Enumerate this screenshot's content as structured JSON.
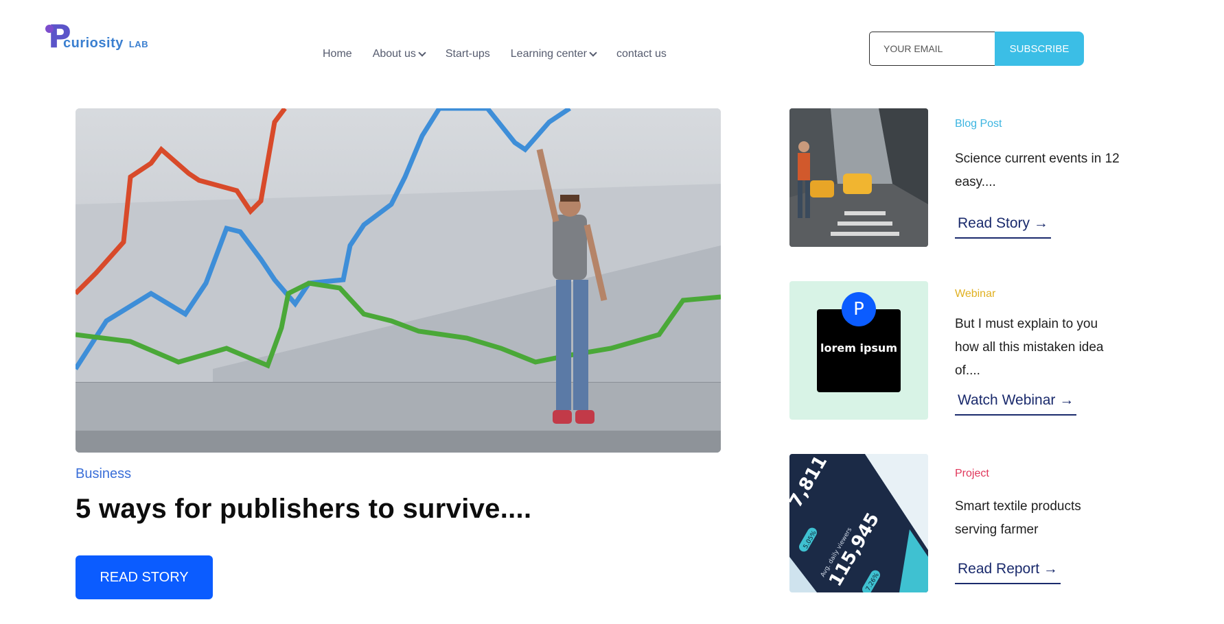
{
  "header": {
    "logo": {
      "letter": "P",
      "word": "curiosity",
      "suffix": "LAB"
    },
    "nav": [
      {
        "label": "Home",
        "dropdown": false
      },
      {
        "label": "About us",
        "dropdown": true
      },
      {
        "label": "Start-ups",
        "dropdown": false
      },
      {
        "label": "Learning center",
        "dropdown": true
      },
      {
        "label": "contact us",
        "dropdown": false
      }
    ],
    "subscribe": {
      "placeholder": "YOUR EMAIL",
      "button": "SUBSCRIBE"
    }
  },
  "hero": {
    "category": "Business",
    "title": "5 ways for publishers to survive....",
    "button": "READ STORY"
  },
  "cards": [
    {
      "tag": "Blog Post",
      "tag_color": "#3bb4e0",
      "text": "Science current events in 12 easy....",
      "link": "Read Story →"
    },
    {
      "tag": "Webinar",
      "tag_color": "#e0b020",
      "text": "But I must explain to you how all this mistaken idea of....",
      "link": "Watch Webinar →",
      "thumb": {
        "avatar_letter": "P",
        "label": "lorem ipsum"
      }
    },
    {
      "tag": "Project",
      "tag_color": "#e0365a",
      "text": "Smart textile products serving farmer",
      "link": "Read Report →",
      "thumb": {
        "numbers": [
          "7,811",
          "115,945",
          "5.05%",
          "7.26%"
        ],
        "caption": "Avg. daily viewers"
      }
    }
  ],
  "colors": {
    "accent": "#0b5cff",
    "subscribe": "#3bbee6",
    "link": "#1a2a6c"
  }
}
